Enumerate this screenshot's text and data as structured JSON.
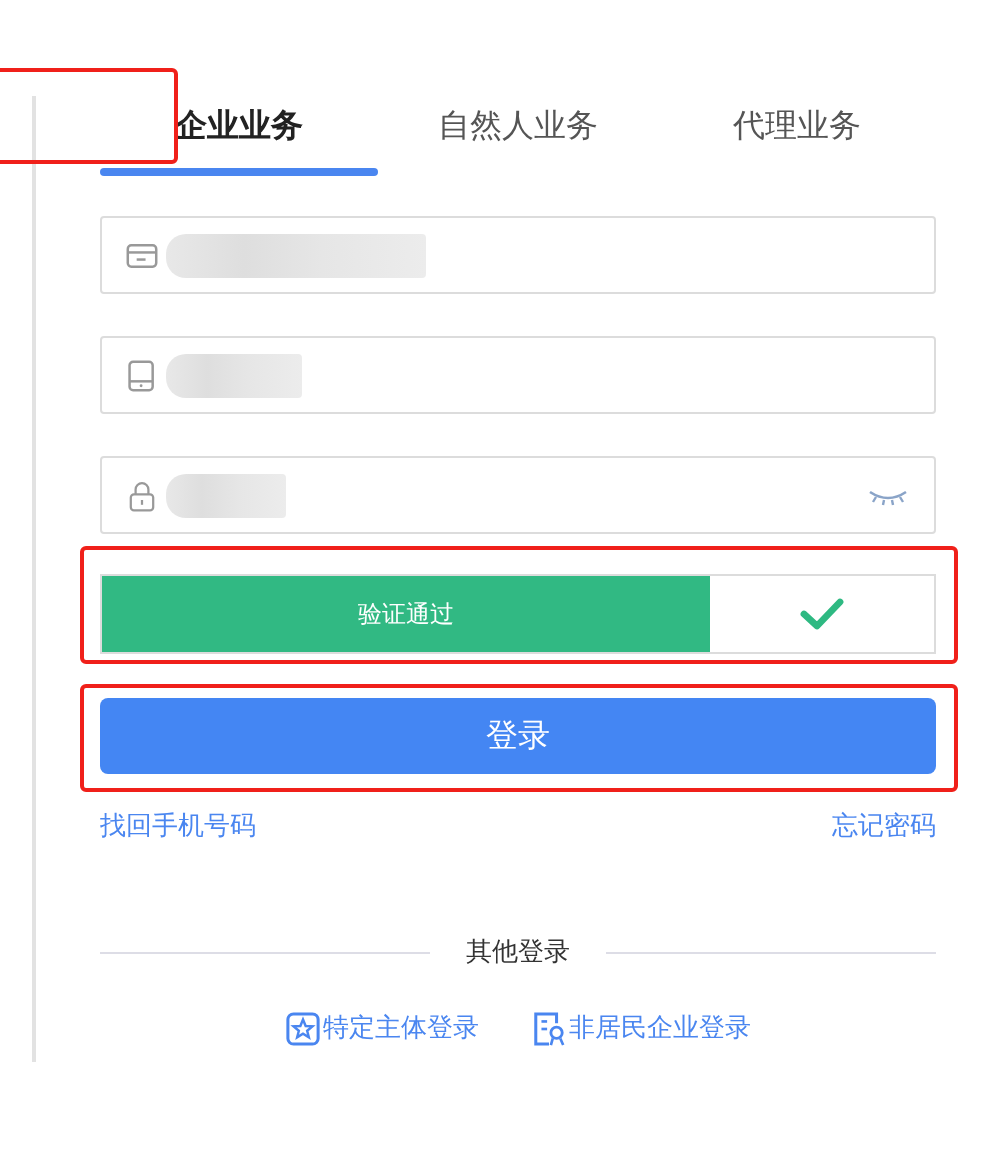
{
  "tabs": [
    {
      "label": "企业业务",
      "selected": true,
      "highlighted": true
    },
    {
      "label": "自然人业务",
      "selected": false,
      "highlighted": false
    },
    {
      "label": "代理业务",
      "selected": false,
      "highlighted": false
    }
  ],
  "fields": [
    {
      "kind": "card"
    },
    {
      "kind": "phone"
    },
    {
      "kind": "password"
    }
  ],
  "verify": {
    "label": "验证通过",
    "level": 0.73,
    "highlighted": true
  },
  "login_button": {
    "label": "登录",
    "highlighted": true
  },
  "links": [
    "找回手机号码",
    "忘记密码"
  ],
  "other_login": {
    "title": "其他登录",
    "options": [
      {
        "kind": "star",
        "label": "特定主体登录"
      },
      {
        "kind": "person",
        "label": "非居民企业登录"
      }
    ]
  }
}
